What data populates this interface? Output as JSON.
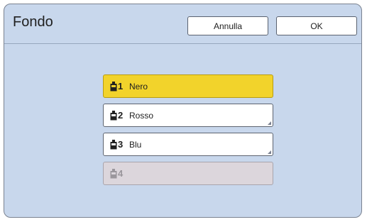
{
  "dialog": {
    "title": "Fondo",
    "cancel_label": "Annulla",
    "ok_label": "OK"
  },
  "colors": {
    "selected": "#f2d32b",
    "background": "#c8d7ec",
    "disabled": "#dcd6dc"
  },
  "items": [
    {
      "num": "1",
      "label": "Nero",
      "state": "selected",
      "icon": "ink-bottle-icon"
    },
    {
      "num": "2",
      "label": "Rosso",
      "state": "normal",
      "icon": "ink-bottle-icon"
    },
    {
      "num": "3",
      "label": "Blu",
      "state": "normal",
      "icon": "ink-bottle-icon"
    },
    {
      "num": "4",
      "label": "",
      "state": "disabled",
      "icon": "ink-bottle-icon"
    }
  ]
}
